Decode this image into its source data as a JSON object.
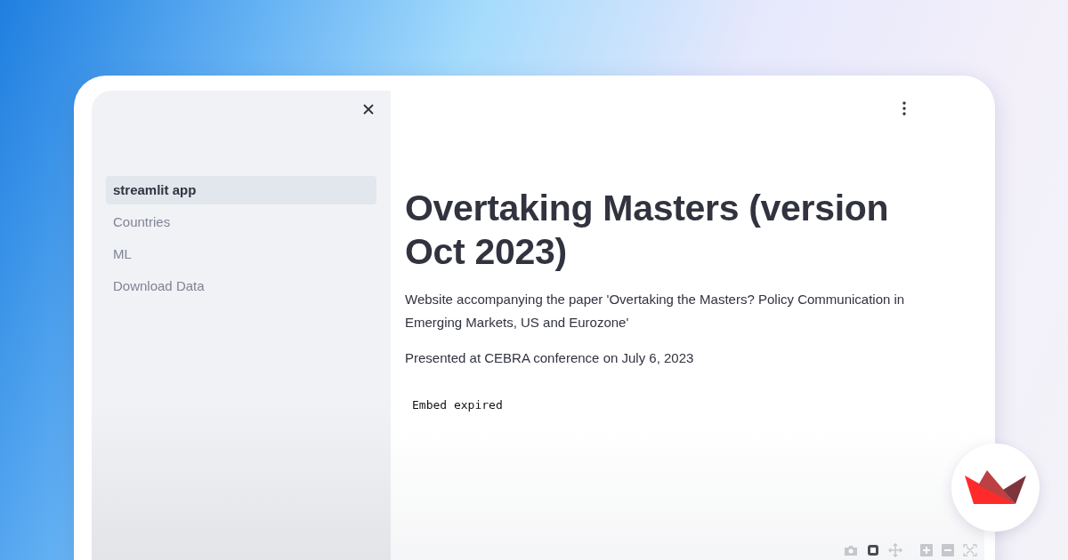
{
  "sidebar": {
    "items": [
      {
        "label": "streamlit app",
        "selected": true
      },
      {
        "label": "Countries",
        "selected": false
      },
      {
        "label": "ML",
        "selected": false
      },
      {
        "label": "Download Data",
        "selected": false
      }
    ]
  },
  "main": {
    "title": "Overtaking Masters (version Oct 2023)",
    "paragraphs": [
      "Website accompanying the paper 'Overtaking the Masters? Policy Communication in Emerging Markets, US and Eurozone'",
      "Presented at CEBRA conference on July 6, 2023"
    ],
    "embed_message": "Embed expired"
  }
}
